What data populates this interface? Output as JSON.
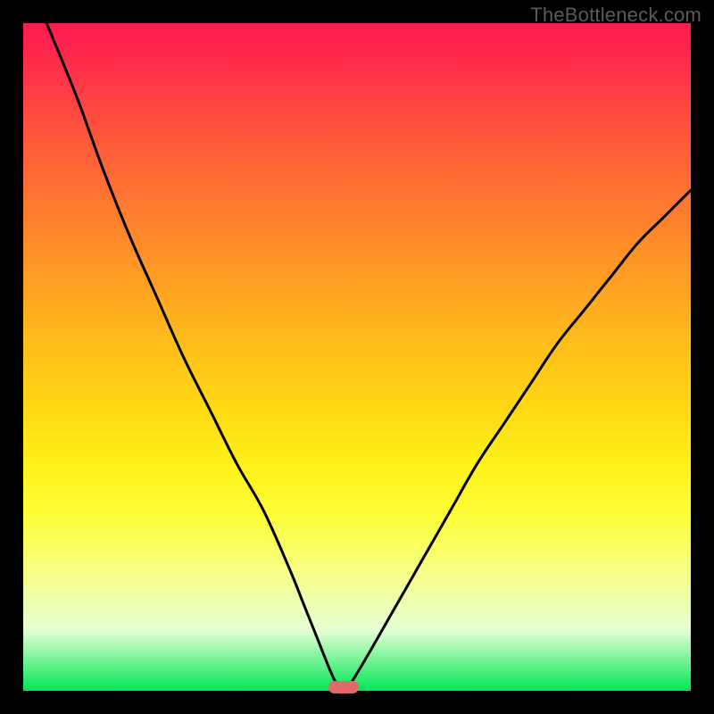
{
  "watermark": "TheBottleneck.com",
  "gradient_colors": {
    "top": "#ff1a50",
    "mid_top": "#ff9d24",
    "mid": "#ffda14",
    "mid_bottom": "#fdff3a",
    "bottom": "#00e756"
  },
  "curve_color": "#000000",
  "marker_color": "#e06a6a",
  "chart_data": {
    "type": "line",
    "title": "",
    "xlabel": "",
    "ylabel": "",
    "xlim": [
      0,
      100
    ],
    "ylim": [
      0,
      100
    ],
    "x": [
      3.5,
      8,
      12,
      16,
      20,
      24,
      28,
      32,
      36,
      40,
      42,
      44,
      46,
      47,
      48,
      49,
      52,
      56,
      60,
      64,
      68,
      72,
      76,
      80,
      84,
      88,
      92,
      96,
      100
    ],
    "y": [
      100,
      89,
      78,
      68,
      59,
      50,
      42,
      34,
      27,
      18,
      13,
      8,
      3,
      1,
      0,
      1,
      6,
      13,
      20,
      27,
      34,
      40,
      46,
      52,
      57,
      62,
      67,
      71,
      75
    ],
    "minimum": {
      "x": 48,
      "y": 0
    },
    "annotations": []
  }
}
